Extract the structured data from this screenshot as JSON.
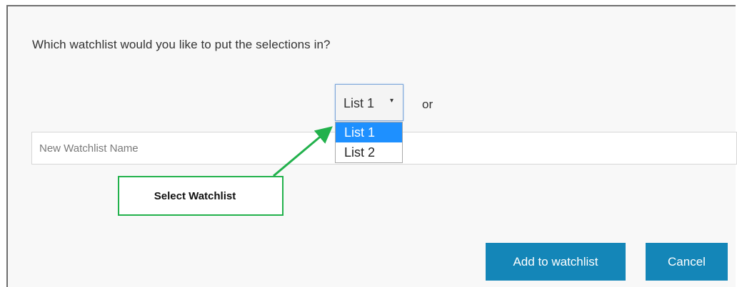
{
  "dialog": {
    "question": "Which watchlist would you like to put the selections in?",
    "select": {
      "value": "List 1",
      "caret": "▾",
      "options": [
        "List 1",
        "List 2"
      ],
      "highlighted": "List 1"
    },
    "or_text": "or",
    "new_name": {
      "placeholder": "New Watchlist Name",
      "value": ""
    },
    "buttons": {
      "add": "Add to watchlist",
      "cancel": "Cancel"
    },
    "colors": {
      "button": "#1486b8",
      "highlight": "#1e90ff",
      "callout": "#22b14c"
    }
  },
  "annotation": {
    "label": "Select Watchlist",
    "icon": "arrow-icon"
  }
}
